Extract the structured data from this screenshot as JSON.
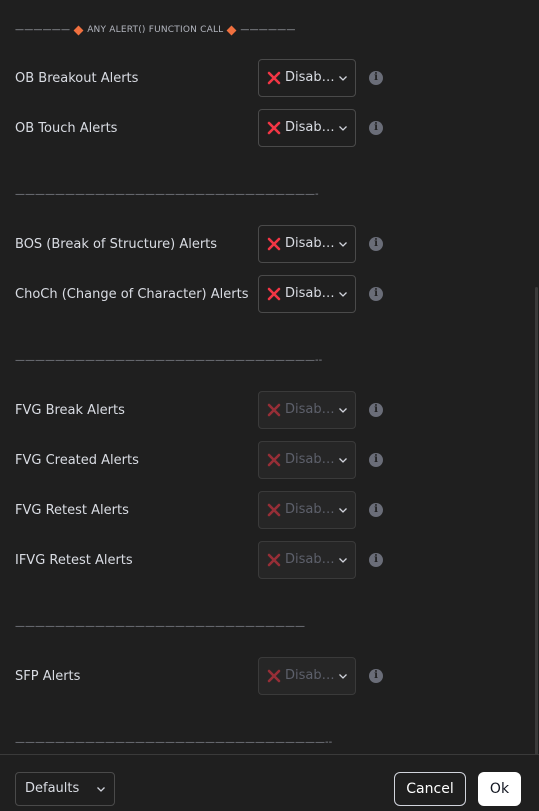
{
  "header": {
    "dashes_left": "——————",
    "title": "ANY ALERT() FUNCTION CALL",
    "dashes_right": "——————"
  },
  "rows": [
    {
      "label": "OB Breakout Alerts",
      "value": "Disab…",
      "disabled": false
    },
    {
      "label": "OB Touch Alerts",
      "value": "Disab…",
      "disabled": false
    },
    {
      "label": "BOS (Break of Structure) Alerts",
      "value": "Disab…",
      "disabled": false
    },
    {
      "label": "ChoCh (Change of Character) Alerts",
      "value": "Disab…",
      "disabled": false
    },
    {
      "label": "FVG Break Alerts",
      "value": "Disab…",
      "disabled": true
    },
    {
      "label": "FVG Created Alerts",
      "value": "Disab…",
      "disabled": true
    },
    {
      "label": "FVG Retest Alerts",
      "value": "Disab…",
      "disabled": true
    },
    {
      "label": "IFVG Retest Alerts",
      "value": "Disab…",
      "disabled": true
    },
    {
      "label": "SFP Alerts",
      "value": "Disab…",
      "disabled": true
    }
  ],
  "separators": [
    "——————————————————————————————-",
    "——————————————————————————————--",
    "—————————————————————————————",
    "———————————————————————————————--"
  ],
  "footer": {
    "defaults_label": "Defaults",
    "cancel_label": "Cancel",
    "ok_label": "Ok"
  },
  "colors": {
    "x_mark": "#f23645",
    "background": "#1f1f1f",
    "accent_diamond": "#f0703f"
  }
}
